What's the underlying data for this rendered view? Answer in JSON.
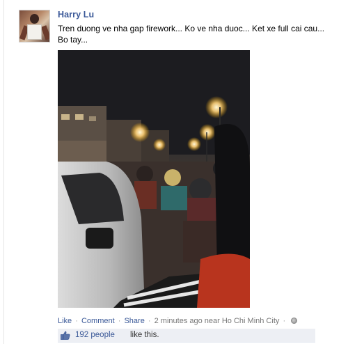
{
  "post": {
    "author": "Harry Lu",
    "message": "Tren duong ve nha gap firework... Ko ve nha duoc... Ket xe full cai cau... Bo tay..."
  },
  "actions": {
    "like": "Like",
    "comment": "Comment",
    "share": "Share",
    "sep": "·",
    "timestamp": "2 minutes ago near Ho Chi Minh City"
  },
  "likes": {
    "count_label": "192 people",
    "suffix": "like this."
  },
  "colors": {
    "link": "#3b5998",
    "likes_bar": "#edeff4"
  },
  "icons": {
    "privacy": "globe-icon",
    "like": "thumbs-up-icon"
  }
}
